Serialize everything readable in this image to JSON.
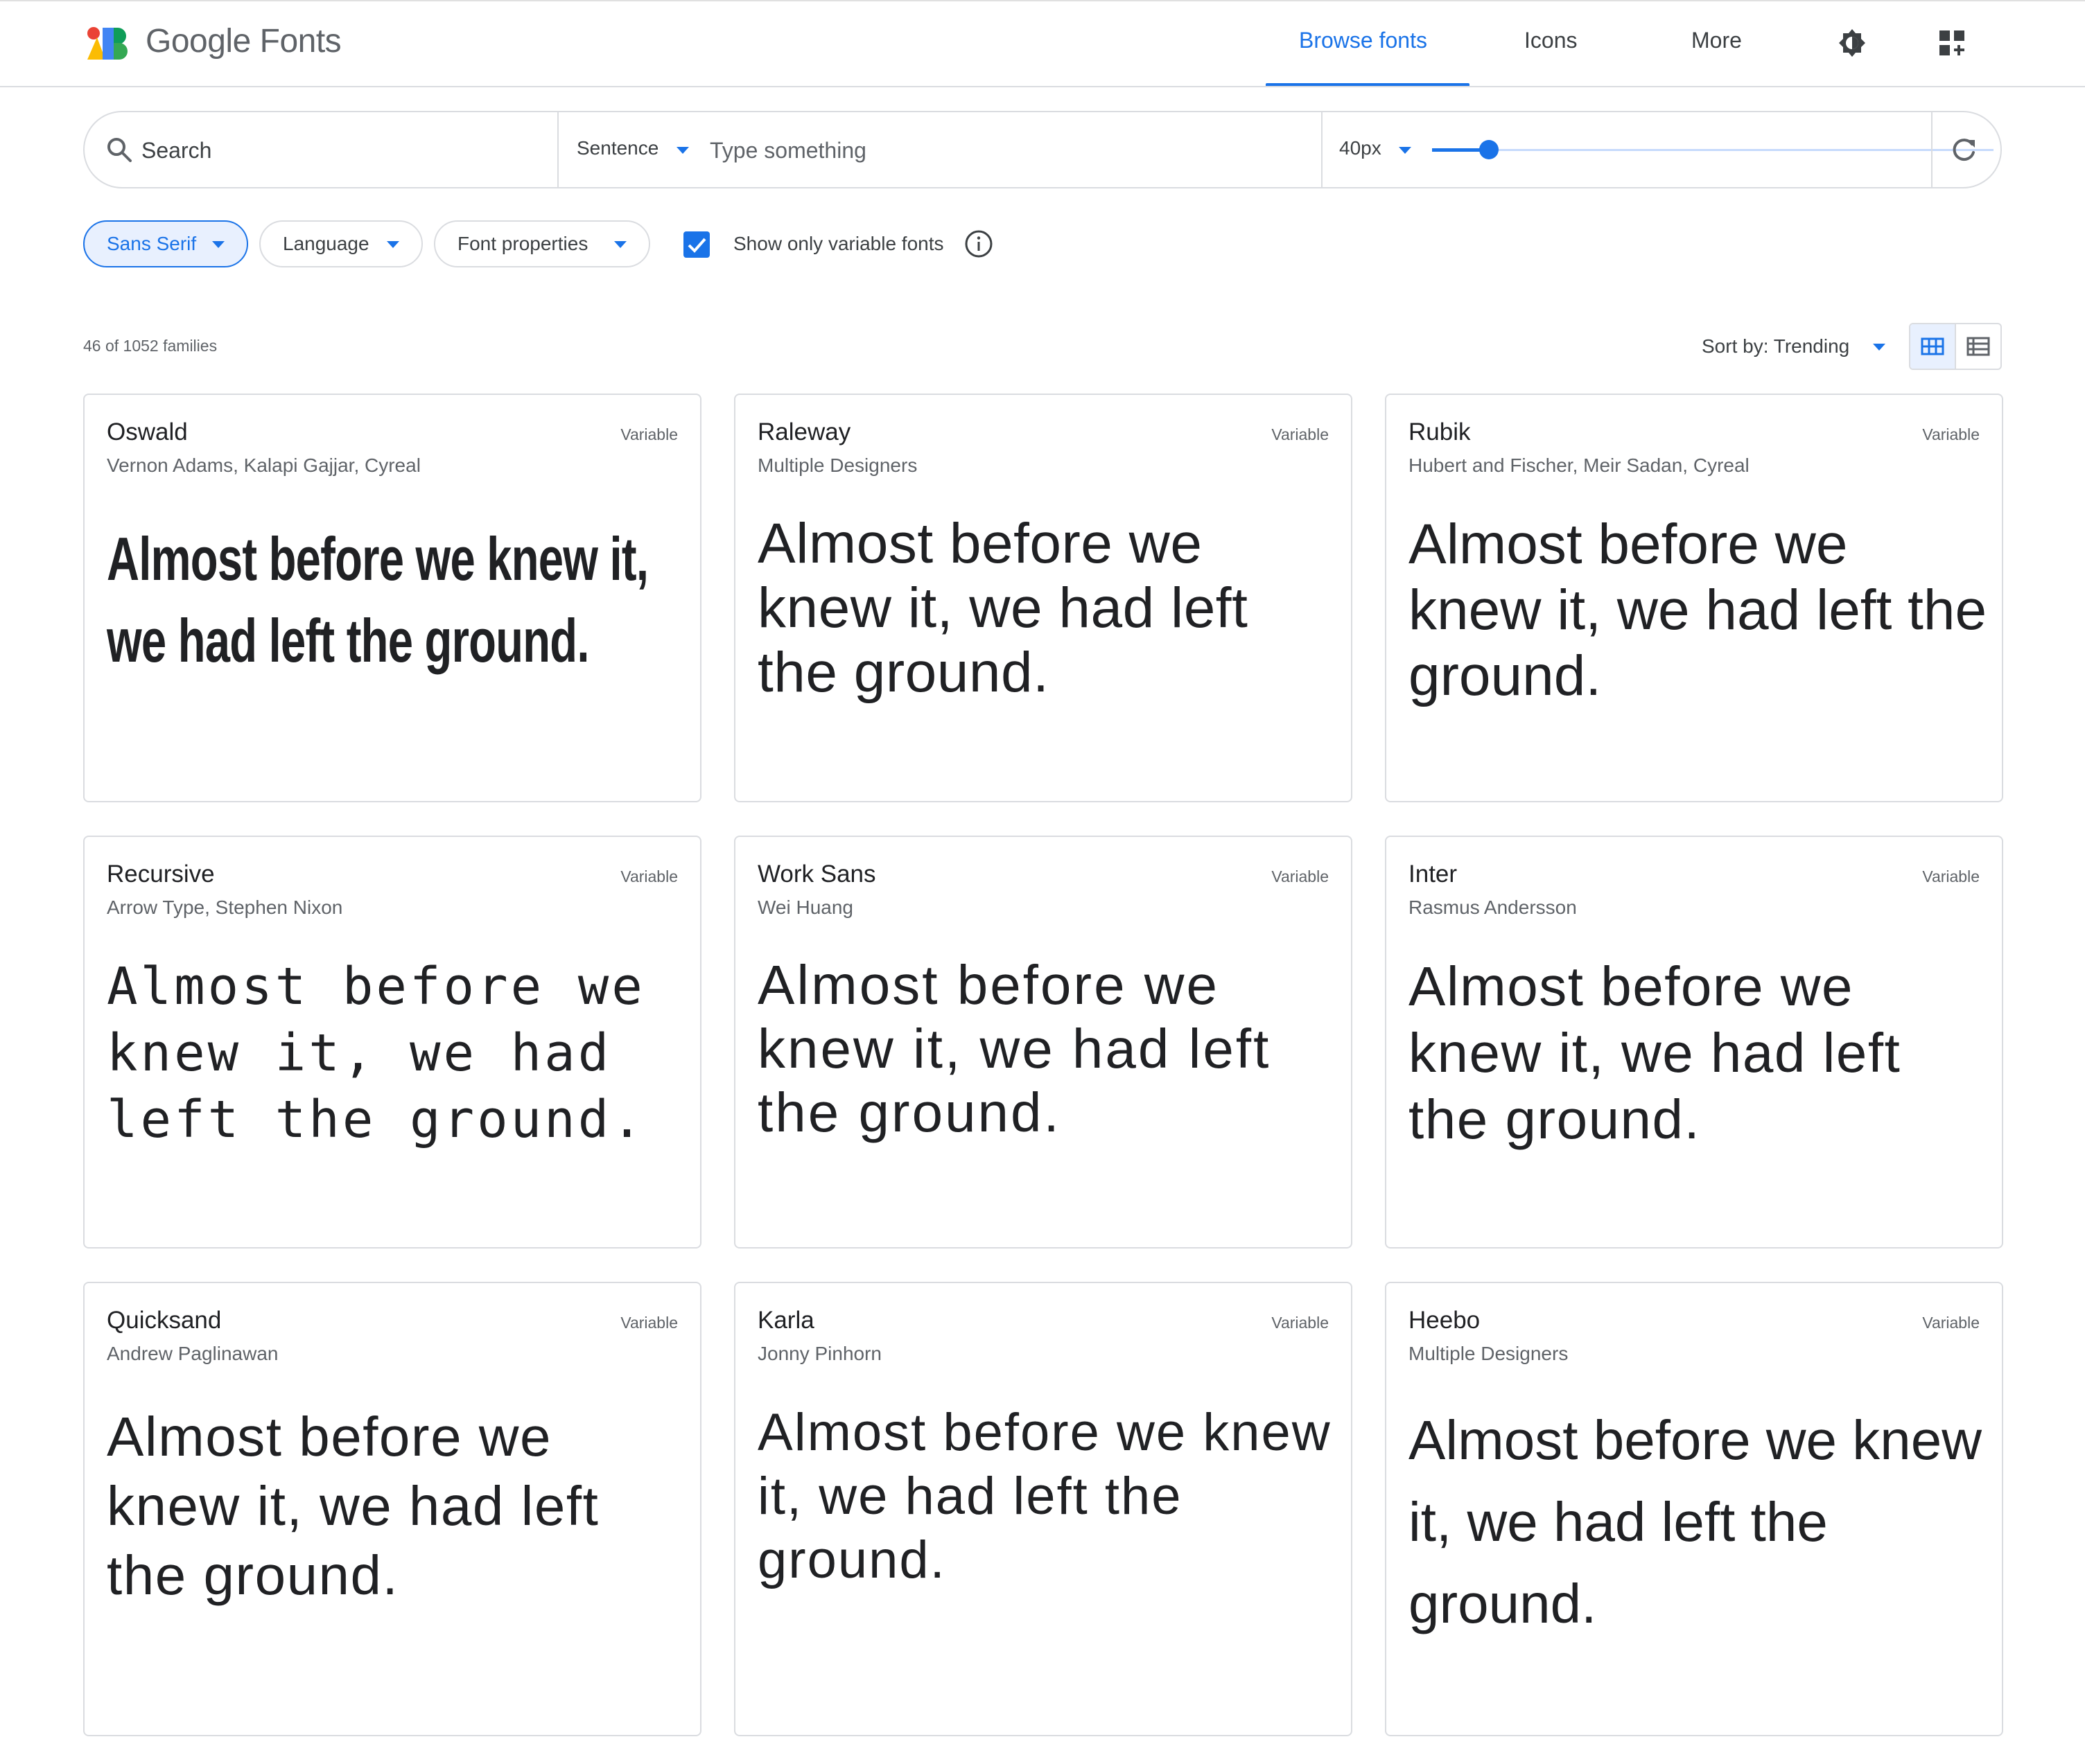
{
  "header": {
    "brand": "Google Fonts",
    "nav": [
      {
        "label": "Browse fonts",
        "active": true
      },
      {
        "label": "Icons",
        "active": false
      },
      {
        "label": "More",
        "active": false
      }
    ],
    "icons": [
      "google-fonts-logo-icon",
      "theme-toggle-icon",
      "apps-grid-icon"
    ]
  },
  "searchbar": {
    "search_placeholder": "Search",
    "preview_mode": "Sentence",
    "preview_placeholder": "Type something",
    "font_size": "40px",
    "font_size_slider_fraction": 0.1
  },
  "filters": {
    "category": "Sans Serif",
    "language": "Language",
    "font_properties": "Font properties",
    "variable_only_label": "Show only variable fonts",
    "variable_only_checked": true
  },
  "results": {
    "count": "46 of 1052 families",
    "sort": "Sort by: Trending",
    "view_mode": "grid"
  },
  "sample_text": "Almost before we knew it, we had left the ground.",
  "fonts": [
    {
      "name": "Oswald",
      "designer": "Vernon Adams, Kalapi Gajjar, Cyreal",
      "badge": "Variable"
    },
    {
      "name": "Raleway",
      "designer": "Multiple Designers",
      "badge": "Variable"
    },
    {
      "name": "Rubik",
      "designer": "Hubert and Fischer, Meir Sadan, Cyreal",
      "badge": "Variable"
    },
    {
      "name": "Recursive",
      "designer": "Arrow Type, Stephen Nixon",
      "badge": "Variable"
    },
    {
      "name": "Work Sans",
      "designer": "Wei Huang",
      "badge": "Variable"
    },
    {
      "name": "Inter",
      "designer": "Rasmus Andersson",
      "badge": "Variable"
    },
    {
      "name": "Quicksand",
      "designer": "Andrew Paglinawan",
      "badge": "Variable"
    },
    {
      "name": "Karla",
      "designer": "Jonny Pinhorn",
      "badge": "Variable"
    },
    {
      "name": "Heebo",
      "designer": "Multiple Designers",
      "badge": "Variable"
    }
  ],
  "colors": {
    "accent": "#1a73e8",
    "text": "#202124",
    "secondary_text": "#5f6368",
    "border": "#dadce0",
    "chip_active_bg": "#e8f0fe"
  }
}
